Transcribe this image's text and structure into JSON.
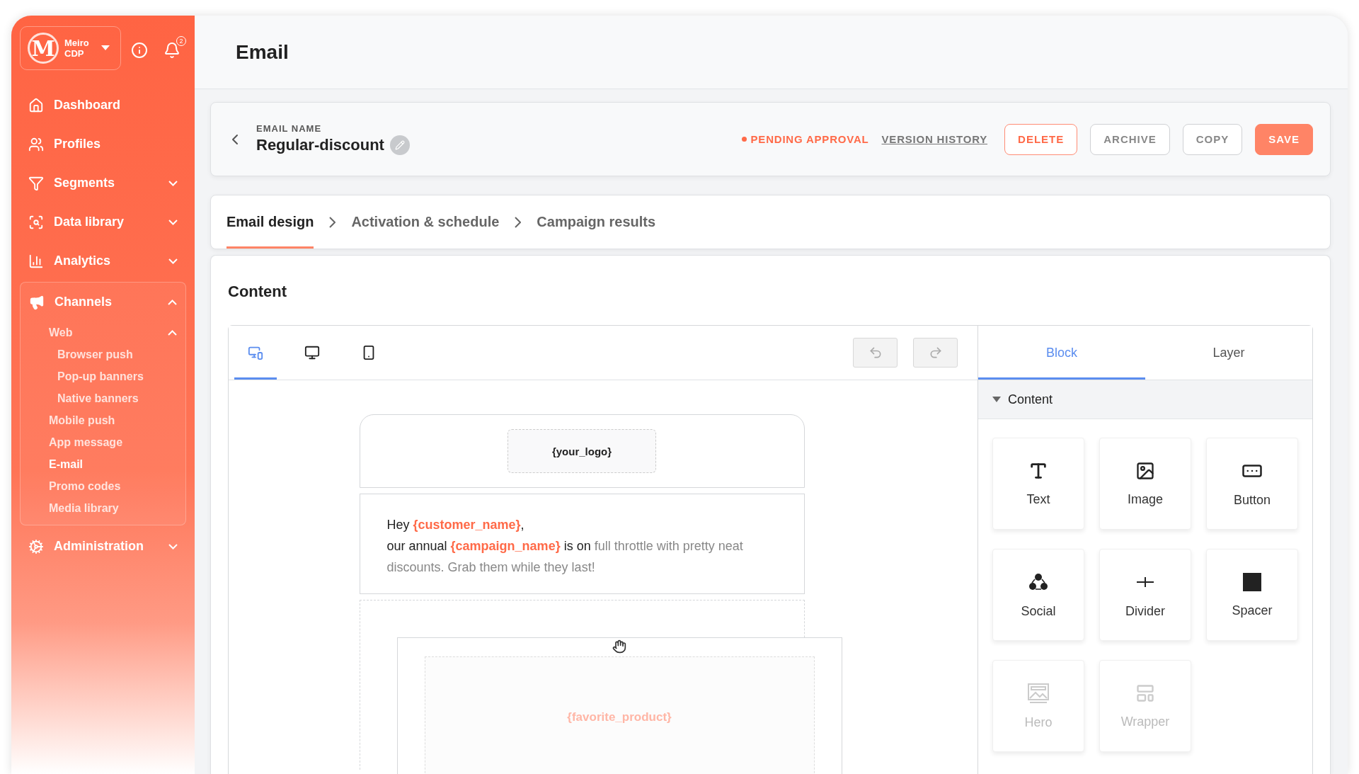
{
  "sidebar": {
    "brand": {
      "logo_mark": "M",
      "name": "Meiro CDP"
    },
    "notification_count": "2",
    "items": [
      {
        "label": "Dashboard"
      },
      {
        "label": "Profiles"
      },
      {
        "label": "Segments",
        "expanded": false
      },
      {
        "label": "Data library",
        "expanded": false
      },
      {
        "label": "Analytics",
        "expanded": false
      },
      {
        "label": "Channels",
        "expanded": true,
        "children": [
          {
            "label": "Web",
            "expanded": true,
            "selected": false,
            "children": [
              {
                "label": "Browser push",
                "selected": false
              },
              {
                "label": "Pop-up banners",
                "selected": false
              },
              {
                "label": "Native banners",
                "selected": false
              }
            ]
          },
          {
            "label": "Mobile push",
            "selected": false
          },
          {
            "label": "App message",
            "selected": false
          },
          {
            "label": "E-mail",
            "selected": true
          },
          {
            "label": "Promo codes",
            "selected": false
          },
          {
            "label": "Media library",
            "selected": false
          }
        ]
      },
      {
        "label": "Administration",
        "expanded": false
      }
    ]
  },
  "page_title": "Email",
  "email_header": {
    "name_label": "EMAIL NAME",
    "name": "Regular-discount",
    "status": "PENDING APPROVAL",
    "version_link": "VERSION HISTORY",
    "buttons": [
      {
        "label": "DELETE",
        "kind": "danger"
      },
      {
        "label": "ARCHIVE",
        "kind": "outline"
      },
      {
        "label": "COPY",
        "kind": "outline"
      },
      {
        "label": "SAVE",
        "kind": "primary"
      }
    ]
  },
  "steps": [
    {
      "label": "Email design",
      "selected": true
    },
    {
      "label": "Activation & schedule",
      "selected": false
    },
    {
      "label": "Campaign results",
      "selected": false
    }
  ],
  "content": {
    "title": "Content",
    "device_tabs": [
      {
        "selected": true
      },
      {
        "selected": false
      },
      {
        "selected": false
      }
    ],
    "history_buttons": [
      {
        "disabled": true
      },
      {
        "disabled": true
      }
    ],
    "template": {
      "logo_placeholder": "{your_logo}",
      "lines": [
        [
          {
            "kind": "plain",
            "text": "Hey "
          },
          {
            "kind": "tag",
            "text": "{customer_name}"
          },
          {
            "kind": "plain",
            "text": ","
          }
        ],
        [
          {
            "kind": "plain",
            "text": "our annual "
          },
          {
            "kind": "tag",
            "text": "{campaign_name}"
          },
          {
            "kind": "plain",
            "text": " is on"
          },
          {
            "kind": "faded",
            "text": " full throttle with pretty neat discounts. Grab them while they last!"
          }
        ]
      ],
      "product_placeholder": "{favorite_product}"
    },
    "panel_tabs": [
      {
        "label": "Block",
        "selected": true
      },
      {
        "label": "Layer",
        "selected": false
      }
    ],
    "section": {
      "label": "Content",
      "expanded": true
    },
    "blocks": [
      {
        "label": "Text",
        "disabled": false
      },
      {
        "label": "Image",
        "disabled": false
      },
      {
        "label": "Button",
        "disabled": false
      },
      {
        "label": "Social",
        "disabled": false
      },
      {
        "label": "Divider",
        "disabled": false
      },
      {
        "label": "Spacer",
        "disabled": false
      },
      {
        "label": "Hero",
        "disabled": true
      },
      {
        "label": "Wrapper",
        "disabled": true
      }
    ]
  }
}
